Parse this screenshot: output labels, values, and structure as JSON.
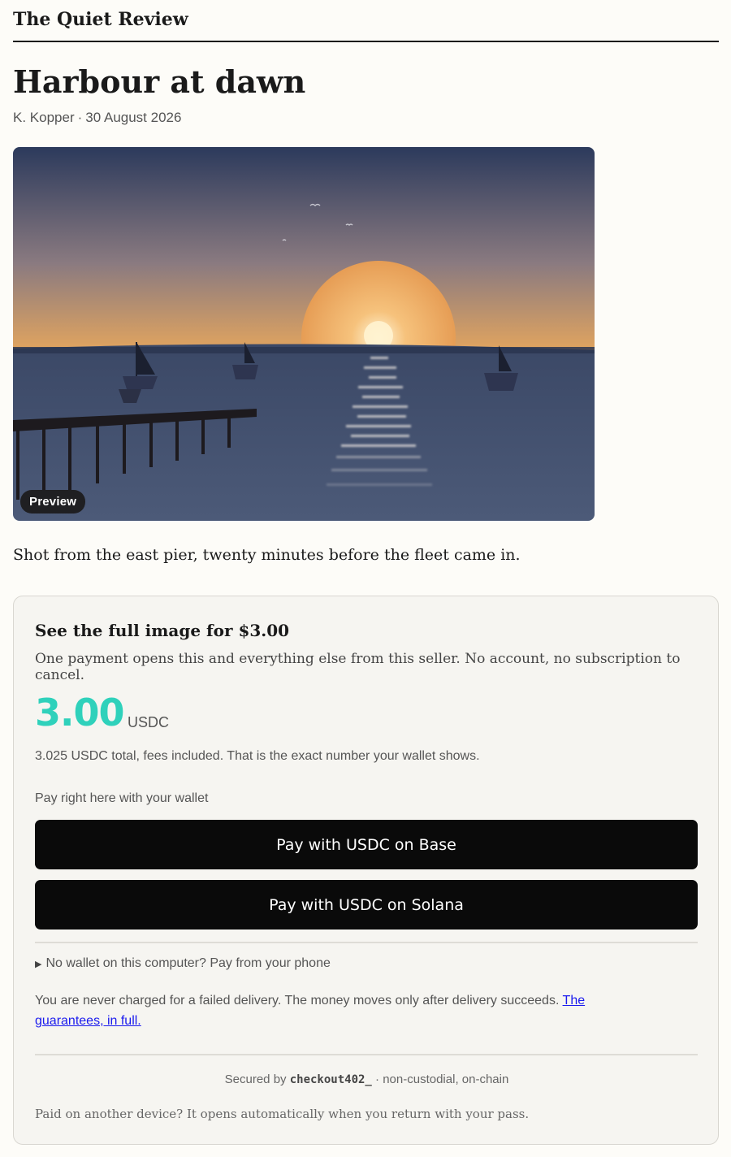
{
  "site": {
    "name": "The Quiet Review"
  },
  "article": {
    "title": "Harbour at dawn",
    "author": "K. Kopper",
    "date": "30 August 2026",
    "caption": "Shot from the east pier, twenty minutes before the fleet came in.",
    "image_badge": "Preview"
  },
  "paywall": {
    "heading": "See the full image for $3.00",
    "description": "One payment opens this and everything else from this seller. No account, no subscription to cancel.",
    "price": "3.00",
    "currency": "USDC",
    "total_note": "3.025 USDC total, fees included. That is the exact number your wallet shows.",
    "pay_label": "Pay right here with your wallet",
    "buttons": {
      "base": "Pay with USDC on Base",
      "solana": "Pay with USDC on Solana"
    },
    "phone_toggle": "No wallet on this computer? Pay from your phone",
    "guarantee_text": "You are never charged for a failed delivery. The money moves only after delivery succeeds.",
    "guarantee_link": "The guarantees, in full.",
    "secured_prefix": "Secured by",
    "secured_brand": "checkout402_",
    "secured_suffix": "non-custodial, on-chain",
    "other_device": "Paid on another device? It opens automatically when you return with your pass."
  },
  "colors": {
    "price_accent": "#2fd1bb",
    "button_bg": "#0a0a0a",
    "link": "#1a1aee"
  }
}
